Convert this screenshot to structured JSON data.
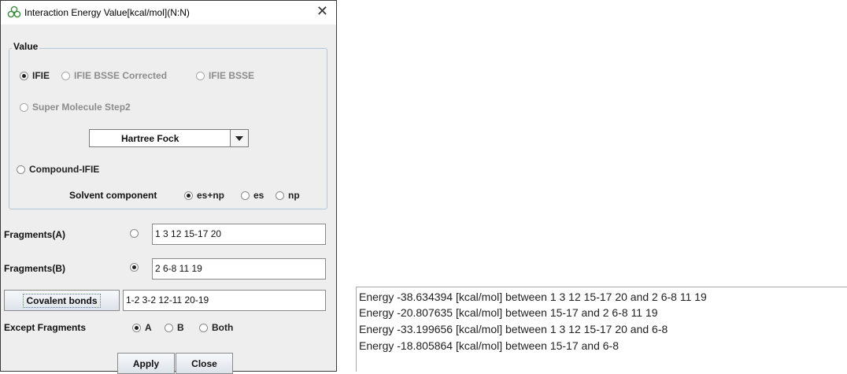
{
  "dialog": {
    "title": "Interaction Energy Value[kcal/mol](N:N)",
    "close_glyph": "✕",
    "app_icon": "flower-icon"
  },
  "value_group": {
    "title": "Value",
    "options_row1": [
      {
        "label": "IFIE",
        "selected": true,
        "enabled": true
      },
      {
        "label": "IFIE BSSE Corrected",
        "selected": false,
        "enabled": false
      },
      {
        "label": "IFIE BSSE",
        "selected": false,
        "enabled": false
      }
    ],
    "super_molecule": {
      "label": "Super Molecule Step2",
      "selected": false,
      "enabled": false
    },
    "method_select": {
      "value": "Hartree Fock"
    },
    "compound_ifie": {
      "label": "Compound-IFIE",
      "selected": false
    },
    "solvent": {
      "label": "Solvent component",
      "options": [
        {
          "label": "es+np",
          "selected": true
        },
        {
          "label": "es",
          "selected": false
        },
        {
          "label": "np",
          "selected": false
        }
      ]
    }
  },
  "fragments_a": {
    "label": "Fragments(A)",
    "selected": false,
    "value": "1 3 12 15-17 20"
  },
  "fragments_b": {
    "label": "Fragments(B)",
    "selected": true,
    "value": "2 6-8 11 19"
  },
  "covalent": {
    "button_label": "Covalent bonds",
    "value": "1-2 3-2 12-11 20-19"
  },
  "except": {
    "label": "Except Fragments",
    "options": [
      {
        "label": "A",
        "selected": true
      },
      {
        "label": "B",
        "selected": false
      },
      {
        "label": "Both",
        "selected": false
      }
    ]
  },
  "buttons": {
    "apply": "Apply",
    "close": "Close"
  },
  "output": {
    "lines": [
      "Energy  -38.634394 [kcal/mol] between 1 3 12 15-17 20  and 2 6-8 11 19",
      "Energy  -20.807635 [kcal/mol] between 15-17  and 2 6-8 11 19",
      "Energy  -33.199656 [kcal/mol] between 1 3 12 15-17 20  and 6-8",
      "Energy  -18.805864 [kcal/mol] between 15-17  and 6-8"
    ]
  }
}
